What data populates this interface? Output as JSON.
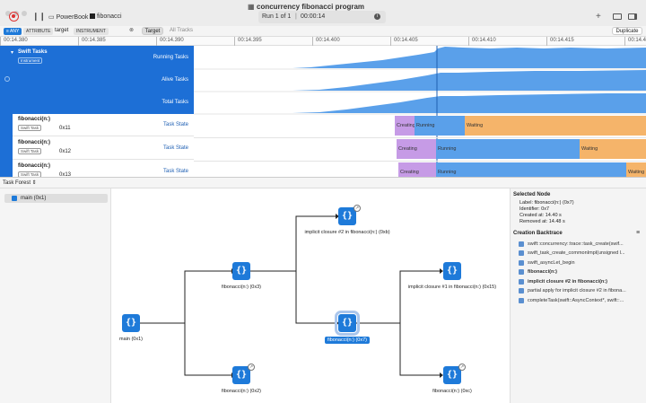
{
  "window": {
    "title": "concurrency fibonacci program",
    "device": "PowerBook",
    "target_app": "fibonacci",
    "run_label": "Run 1 of 1",
    "elapsed": "00:00:14"
  },
  "filter": {
    "any": "≡ ANY",
    "attribute": "ATTRIBUTE",
    "field": "target",
    "instrument": "INSTRUMENT",
    "target_btn": "Target",
    "all_tracks": "All Tracks",
    "duplicate": "Duplicate"
  },
  "ruler": {
    "ticks": [
      "00:14.380",
      "00:14.385",
      "00:14.390",
      "00:14.395",
      "00:14.400",
      "00:14.405",
      "00:14.410",
      "00:14.415",
      "00:14.4"
    ]
  },
  "tracks": {
    "swift_tasks": "Swift Tasks",
    "instrument_badge": "Instrument",
    "running": "Running Tasks",
    "alive": "Alive Tasks",
    "total": "Total Tasks",
    "tasks": [
      {
        "name": "fibonacci(n:)",
        "tag": "Swift Task",
        "id": "0x11",
        "state_label": "Task State"
      },
      {
        "name": "fibonacci(n:)",
        "tag": "Swift Task",
        "id": "0x12",
        "state_label": "Task State"
      },
      {
        "name": "fibonacci(n:)",
        "tag": "Swift Task",
        "id": "0x13",
        "state_label": "Task State"
      }
    ],
    "states": {
      "creating": "Creating",
      "running": "Running",
      "waiting": "Waiting"
    }
  },
  "forest": {
    "header": "Task Forest",
    "sidebar_item": "main (0x1)",
    "nodes": [
      {
        "label": "main (0x1)"
      },
      {
        "label": "fibonacci(n:) (0x3)"
      },
      {
        "label": "fibonacci(n:) (0x2)"
      },
      {
        "label": "implicit closure #2 in fibonacci(n:) (0xb)"
      },
      {
        "label": "fibonacci(n:) (0x7)"
      },
      {
        "label": "implicit closure #1 in fibonacci(n:) (0x15)"
      },
      {
        "label": "fibonacci(n:) (0xc)"
      }
    ]
  },
  "inspector": {
    "selected_title": "Selected Node",
    "label_line": "Label: fibonacci(n:) (0x7)",
    "identifier_line": "Identifier: 0x7",
    "created_line": "Created at: 14.40 s",
    "removed_line": "Removed at: 14.48 s",
    "backtrace_title": "Creation Backtrace",
    "backtrace": [
      "swift::concurrency::trace::task_create(swif...",
      "swift_task_create_commonImpl(unsigned l...",
      "swift_asyncLet_begin",
      "fibonacci(n:)",
      "implicit closure #2 in fibonacci(n:)",
      "partial apply for implicit closure #2 in fibona...",
      "completeTask(swift::AsyncContext*, swift::..."
    ]
  },
  "colors": {
    "accent": "#1e7ad9",
    "graph": "#5aa0ea",
    "creating": "#c69be6",
    "running": "#5aa0ea",
    "waiting": "#f5b46a"
  }
}
